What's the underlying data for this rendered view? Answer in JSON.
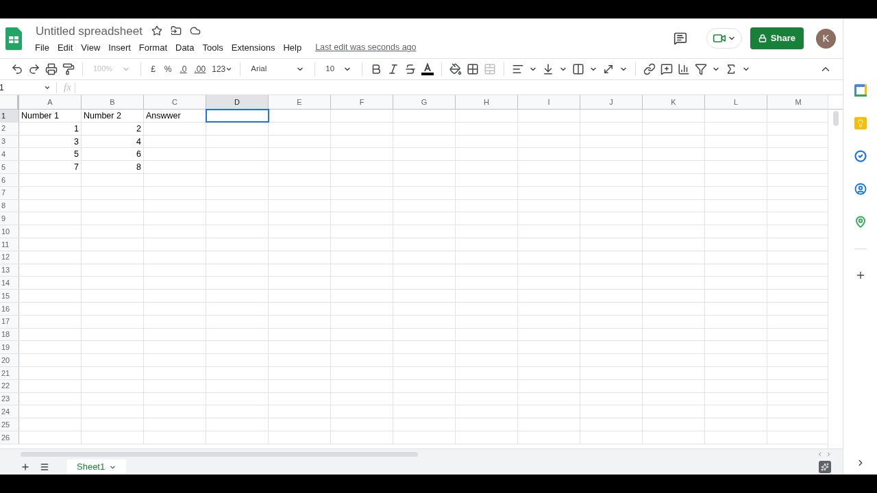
{
  "header": {
    "title": "Untitled spreadsheet",
    "menu": [
      "File",
      "Edit",
      "View",
      "Insert",
      "Format",
      "Data",
      "Tools",
      "Extensions",
      "Help"
    ],
    "last_edit": "Last edit was seconds ago",
    "share": "Share",
    "avatar": "K"
  },
  "toolbar": {
    "zoom": "100%",
    "currency": "£",
    "percent": "%",
    "decrease_decimals": ".0",
    "increase_decimals": ".00",
    "more_formats": "123",
    "font": "Arial",
    "font_size": "10"
  },
  "formula_bar": {
    "name_box": "1",
    "fx_label": "fx"
  },
  "grid": {
    "columns": [
      {
        "label": "A",
        "selected": false
      },
      {
        "label": "B",
        "selected": false
      },
      {
        "label": "C",
        "selected": false
      },
      {
        "label": "D",
        "selected": true
      },
      {
        "label": "E",
        "selected": false
      },
      {
        "label": "F",
        "selected": false
      },
      {
        "label": "G",
        "selected": false
      },
      {
        "label": "H",
        "selected": false
      },
      {
        "label": "I",
        "selected": false
      },
      {
        "label": "J",
        "selected": false
      },
      {
        "label": "K",
        "selected": false
      },
      {
        "label": "L",
        "selected": false
      },
      {
        "label": "M",
        "selected": false
      }
    ],
    "rows": [
      {
        "label": "1",
        "selected": true,
        "cells": [
          {
            "text": "Number 1",
            "kind": "text"
          },
          {
            "text": "Number 2",
            "kind": "text"
          },
          {
            "text": "Answwer",
            "kind": "text"
          }
        ]
      },
      {
        "label": "2",
        "selected": false,
        "cells": [
          {
            "text": "1",
            "kind": "number"
          },
          {
            "text": "2",
            "kind": "number"
          }
        ]
      },
      {
        "label": "3",
        "selected": false,
        "cells": [
          {
            "text": "3",
            "kind": "number"
          },
          {
            "text": "4",
            "kind": "number"
          }
        ]
      },
      {
        "label": "4",
        "selected": false,
        "cells": [
          {
            "text": "5",
            "kind": "number"
          },
          {
            "text": "6",
            "kind": "number"
          }
        ]
      },
      {
        "label": "5",
        "selected": false,
        "cells": [
          {
            "text": "7",
            "kind": "number"
          },
          {
            "text": "8",
            "kind": "number"
          }
        ]
      },
      {
        "label": "6",
        "selected": false
      },
      {
        "label": "7",
        "selected": false
      },
      {
        "label": "8",
        "selected": false
      },
      {
        "label": "9",
        "selected": false
      },
      {
        "label": "10",
        "selected": false
      },
      {
        "label": "11",
        "selected": false
      },
      {
        "label": "12",
        "selected": false
      },
      {
        "label": "13",
        "selected": false
      },
      {
        "label": "14",
        "selected": false
      },
      {
        "label": "15",
        "selected": false
      },
      {
        "label": "16",
        "selected": false
      },
      {
        "label": "17",
        "selected": false
      },
      {
        "label": "18",
        "selected": false
      },
      {
        "label": "19",
        "selected": false
      },
      {
        "label": "20",
        "selected": false
      },
      {
        "label": "21",
        "selected": false
      },
      {
        "label": "22",
        "selected": false
      },
      {
        "label": "23",
        "selected": false
      },
      {
        "label": "24",
        "selected": false
      },
      {
        "label": "25",
        "selected": false
      },
      {
        "label": "26",
        "selected": false
      }
    ]
  },
  "sheet_tabs": [
    {
      "label": "Sheet1",
      "selected": true
    }
  ]
}
